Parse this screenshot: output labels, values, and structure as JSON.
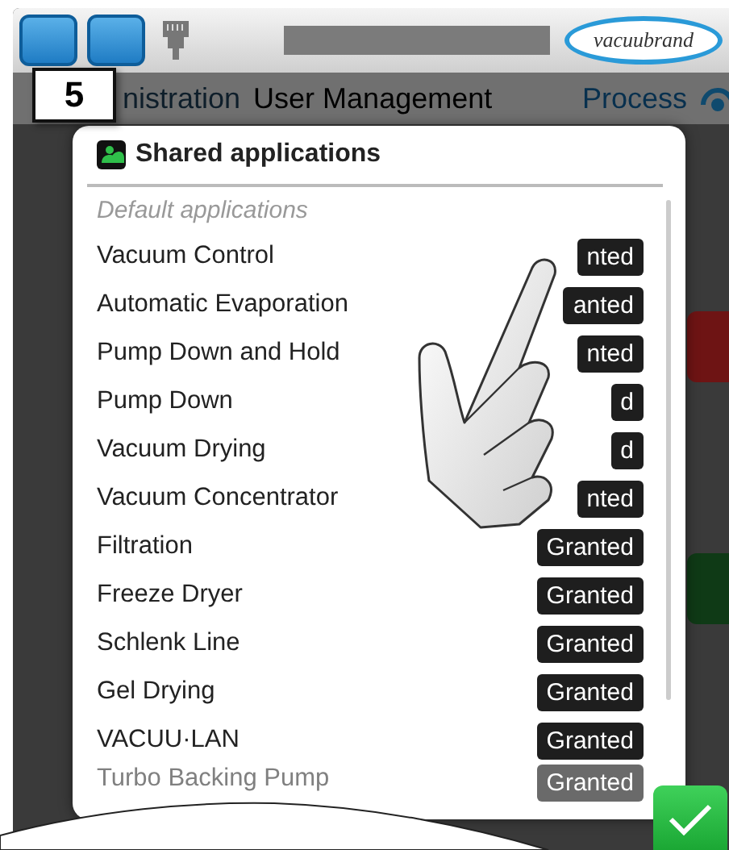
{
  "header": {
    "logo": "vacuubrand"
  },
  "step_label": "5",
  "nav": [
    {
      "label": "nistration",
      "selected": false
    },
    {
      "label": "User Management",
      "selected": true
    },
    {
      "label": "Process",
      "selected": false
    }
  ],
  "dialog": {
    "title": "Shared applications",
    "section": "Default applications",
    "apps": [
      {
        "name": "Vacuum Control",
        "status": "nted"
      },
      {
        "name": "Automatic Evaporation",
        "status": "anted"
      },
      {
        "name": "Pump Down and Hold",
        "status": "nted"
      },
      {
        "name": "Pump Down",
        "status": "d"
      },
      {
        "name": "Vacuum Drying",
        "status": "d"
      },
      {
        "name": "Vacuum Concentrator",
        "status": "nted"
      },
      {
        "name": "Filtration",
        "status": "Granted"
      },
      {
        "name": "Freeze Dryer",
        "status": "Granted"
      },
      {
        "name": "Schlenk Line",
        "status": "Granted"
      },
      {
        "name": "Gel Drying",
        "status": "Granted"
      },
      {
        "name": "VACUU·LAN",
        "status": "Granted"
      }
    ],
    "faded_app": {
      "name": "Turbo Backing Pump",
      "status": "Granted"
    }
  }
}
